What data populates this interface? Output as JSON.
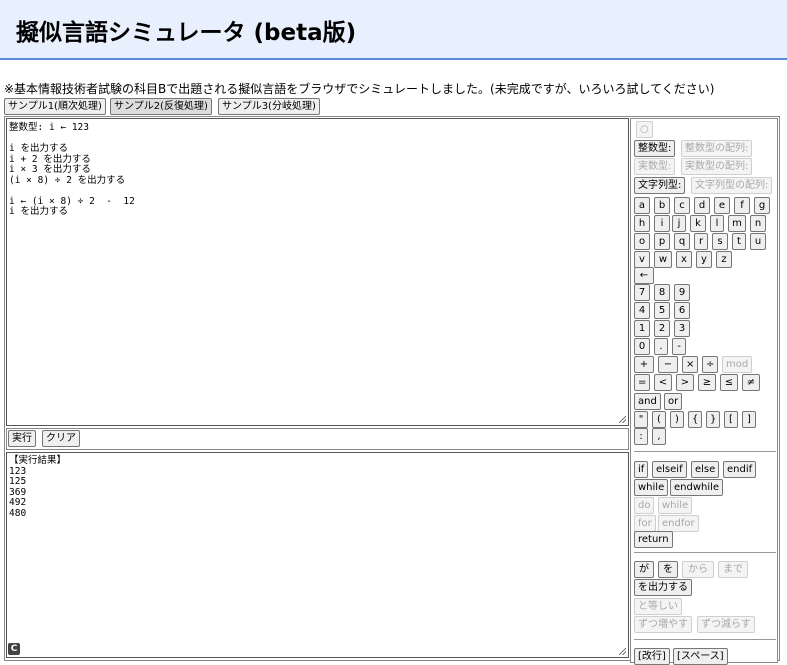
{
  "header": {
    "title": "擬似言語シミュレータ (beta版)"
  },
  "description": "※基本情報技術者試験の科目Bで出題される擬似言語をブラウザでシミュレートしました。(未完成ですが、いろいろ試してください)",
  "samples": [
    "サンプル1(順次処理)",
    "サンプル2(反復処理)",
    "サンプル3(分岐処理)"
  ],
  "editor": {
    "code": "整数型: i ← 123\n\ni を出力する\ni + 2 を出力する\ni × 3 を出力する\n(i × 8) ÷ 2 を出力する\n\ni ← (i × 8) ÷ 2  -  12\ni を出力する"
  },
  "actions": {
    "run": "実行",
    "clear": "クリア"
  },
  "output": {
    "text": "【実行結果】\n123\n125\n369\n492\n480"
  },
  "palette": {
    "circle": "○",
    "types": [
      "整数型:",
      "整数型の配列:",
      "実数型:",
      "実数型の配列:",
      "文字列型:",
      "文字列型の配列:"
    ],
    "letters": [
      "a",
      "b",
      "c",
      "d",
      "e",
      "f",
      "g",
      "h",
      "i",
      "j",
      "k",
      "l",
      "m",
      "n",
      "o",
      "p",
      "q",
      "r",
      "s",
      "t",
      "u",
      "v",
      "w",
      "x",
      "y",
      "z"
    ],
    "arrow": "←",
    "digits": [
      "7",
      "8",
      "9",
      "4",
      "5",
      "6",
      "1",
      "2",
      "3",
      "0",
      ".",
      "-"
    ],
    "ops": [
      "+",
      "−",
      "×",
      "÷",
      "mod"
    ],
    "compare": [
      "=",
      "<",
      ">",
      "≥",
      "≤",
      "≠"
    ],
    "logic": [
      "and",
      "or"
    ],
    "brackets": [
      "\"",
      "(",
      ")",
      "{",
      "}",
      "[",
      "]",
      ":",
      ","
    ],
    "control": [
      "if",
      "elseif",
      "else",
      "endif",
      "while",
      "endwhile",
      "do",
      "while",
      "for",
      "endfor",
      "return"
    ],
    "words": [
      "が",
      "を",
      "から",
      "まで",
      "を出力する",
      "と等しい",
      "ずつ増やす",
      "ずつ減らす"
    ],
    "misc": [
      "[改行]",
      "[スペース]"
    ]
  }
}
